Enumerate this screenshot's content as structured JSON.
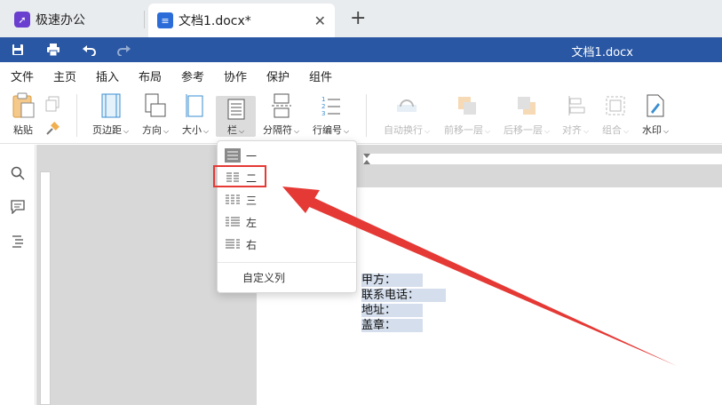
{
  "tabs": {
    "home_label": "极速办公",
    "doc_label": "文档1.docx*",
    "close_glyph": "✕",
    "new_tab_glyph": "+"
  },
  "titlebar": {
    "doc_title": "文档1.docx"
  },
  "menu": {
    "items": [
      "文件",
      "主页",
      "插入",
      "布局",
      "参考",
      "协作",
      "保护",
      "组件"
    ],
    "active": "布局"
  },
  "ribbon": {
    "paste": "粘贴",
    "margins": "页边距",
    "orientation": "方向",
    "size": "大小",
    "columns": "栏",
    "breaks": "分隔符",
    "line_numbers": "行编号",
    "wrap": "自动换行",
    "bring_forward": "前移一层",
    "send_backward": "后移一层",
    "align": "对齐",
    "group": "组合",
    "watermark": "水印"
  },
  "dropdown": {
    "items": [
      "一",
      "二",
      "三",
      "左",
      "右"
    ],
    "current": "一",
    "highlighted": "二",
    "custom": "自定义列"
  },
  "document": {
    "lines": [
      "甲方：",
      "联系电话：",
      "地址：",
      "盖章："
    ]
  },
  "colors": {
    "title_bar": "#2957a4",
    "accent": "#2b6cd8",
    "annotation_red": "#e53935",
    "selection": "#d5deec"
  }
}
